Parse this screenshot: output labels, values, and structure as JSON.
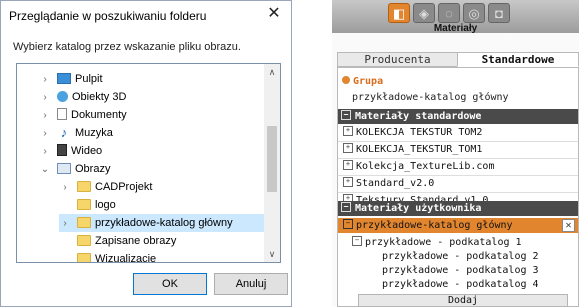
{
  "dialog": {
    "title": "Przeglądanie w poszukiwaniu folderu",
    "close": "✕",
    "instruction": "Wybierz katalog przez wskazanie pliku obrazu.",
    "tree": [
      {
        "label": "Pulpit",
        "icon": "desktop-icon"
      },
      {
        "label": "Obiekty 3D",
        "icon": "objects-3d-icon"
      },
      {
        "label": "Dokumenty",
        "icon": "documents-icon"
      },
      {
        "label": "Muzyka",
        "icon": "music-icon"
      },
      {
        "label": "Wideo",
        "icon": "video-icon"
      },
      {
        "label": "Obrazy",
        "icon": "pictures-icon"
      },
      {
        "label": "CADProjekt",
        "icon": "folder-icon"
      },
      {
        "label": "logo",
        "icon": "folder-icon"
      },
      {
        "label": "przykładowe-katalog główny",
        "icon": "folder-icon"
      },
      {
        "label": "Zapisane obrazy",
        "icon": "folder-icon"
      },
      {
        "label": "Wizualizacje",
        "icon": "folder-icon"
      }
    ],
    "ok": "OK",
    "cancel": "Anuluj"
  },
  "panel": {
    "title": "Materiały",
    "tabs": [
      "Producenta",
      "Standardowe"
    ],
    "group_label": "Grupa",
    "group_value": "przykładowe-katalog główny",
    "std_header": "Materiały standardowe",
    "std_items": [
      "KOLEKCJA TEKSTUR TOM2",
      "KOLEKCJA_TEKSTUR_TOM1",
      "Kolekcja_TextureLib.com",
      "Standard_v2.0",
      "Tekstury Standard v1.0"
    ],
    "user_header": "Materiały użytkownika",
    "user_selected": "przykładowe-katalog główny",
    "user_sub": "przykładowe - podkatalog 1",
    "user_subsub": [
      "przykładowe - podkatalog 2",
      "przykładowe - podkatalog 3",
      "przykładowe - podkatalog 4"
    ],
    "add_button": "Dodaj",
    "accent": "#e2852f"
  }
}
